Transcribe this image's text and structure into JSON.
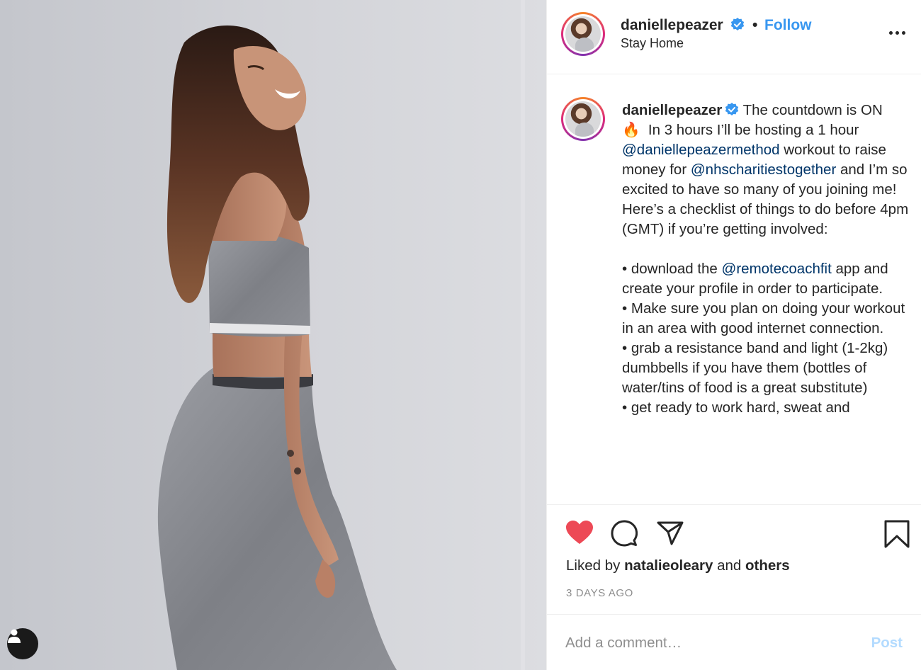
{
  "post": {
    "username": "daniellepeazer",
    "verified": true,
    "separator": "•",
    "follow_label": "Follow",
    "location": "Stay Home",
    "more_icon": "more-options-icon"
  },
  "caption": {
    "username": "daniellepeazer",
    "segments": [
      {
        "type": "text",
        "text": " The countdown is ON \n"
      },
      {
        "type": "emoji",
        "text": "🔥"
      },
      {
        "type": "text",
        "text": "  In 3 hours I’ll be hosting a 1 hour "
      },
      {
        "type": "mention",
        "text": "@daniellepeazermethod"
      },
      {
        "type": "text",
        "text": " workout to raise money for "
      },
      {
        "type": "mention",
        "text": "@nhscharitiestogether"
      },
      {
        "type": "text",
        "text": " and I’m so excited to have so many of you joining me! Here’s a checklist of things to do before 4pm (GMT) if you’re getting involved:\n\n• download the "
      },
      {
        "type": "mention",
        "text": "@remotecoachfit"
      },
      {
        "type": "text",
        "text": " app and create your profile in order to participate.\n• Make sure you plan on doing your workout in an area with good internet connection.\n• grab a resistance band and light (1-2kg) dumbbells if you have them (bottles of water/tins of food is a great substitute)\n• get ready to work hard, sweat and"
      }
    ]
  },
  "actions": {
    "like_icon": "heart-icon",
    "comment_icon": "comment-icon",
    "share_icon": "share-icon",
    "save_icon": "bookmark-icon",
    "liked": true,
    "like_color": "#ed4956"
  },
  "likes": {
    "prefix": "Liked by",
    "user": "natalieoleary",
    "conjunction": "and",
    "others": "others"
  },
  "timestamp": "3 DAYS AGO",
  "comment": {
    "placeholder": "Add a comment…",
    "post_label": "Post"
  },
  "photo": {
    "tag_icon": "user-tag-icon"
  }
}
